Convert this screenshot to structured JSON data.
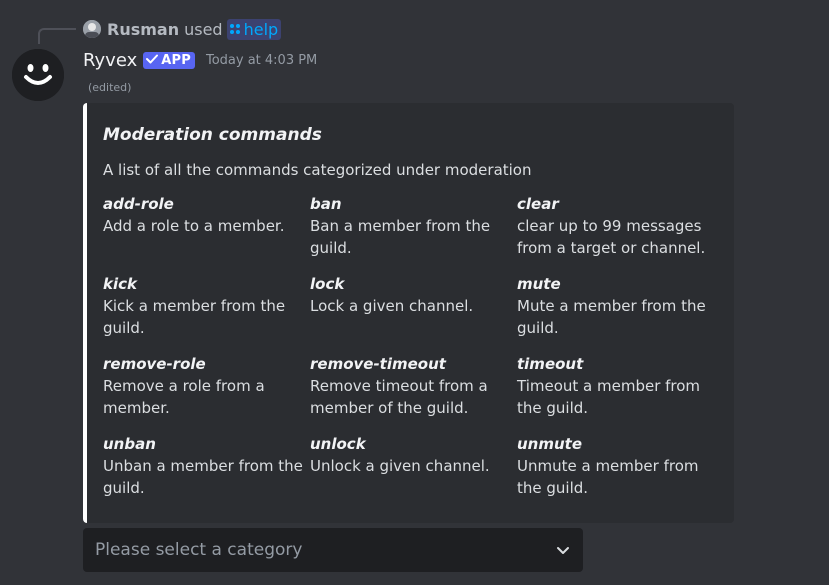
{
  "interaction": {
    "username": "Rusman",
    "used_text": "used",
    "command": "help"
  },
  "message": {
    "bot_name": "Ryvex",
    "badge": "APP",
    "timestamp": "Today at 4:03 PM",
    "edited": "(edited)"
  },
  "embed": {
    "accent_color": "#ffffff",
    "title": "Moderation commands",
    "description": "A list of all the commands categorized under moderation",
    "fields": [
      {
        "name": "add-role",
        "value": "Add a role to a member."
      },
      {
        "name": "ban",
        "value": "Ban a member from the guild."
      },
      {
        "name": "clear",
        "value": "clear up to 99 messages from a target or channel."
      },
      {
        "name": "kick",
        "value": "Kick a member from the guild."
      },
      {
        "name": "lock",
        "value": "Lock a given channel."
      },
      {
        "name": "mute",
        "value": "Mute a member from the guild."
      },
      {
        "name": "remove-role",
        "value": "Remove a role from a member."
      },
      {
        "name": "remove-timeout",
        "value": "Remove timeout from a member of the guild."
      },
      {
        "name": "timeout",
        "value": "Timeout a member from the guild."
      },
      {
        "name": "unban",
        "value": "Unban a member from the guild."
      },
      {
        "name": "unlock",
        "value": "Unlock a given channel."
      },
      {
        "name": "unmute",
        "value": "Unmute a member from the guild."
      }
    ]
  },
  "select": {
    "placeholder": "Please select a category"
  },
  "colors": {
    "background": "#313338",
    "embed_bg": "#2b2d31",
    "brand": "#5865f2",
    "link": "#00a8fc"
  },
  "icons": {
    "avatar": "smiley-face-icon",
    "command": "slash-command-icon",
    "badge": "check-icon",
    "select": "chevron-down-icon"
  }
}
